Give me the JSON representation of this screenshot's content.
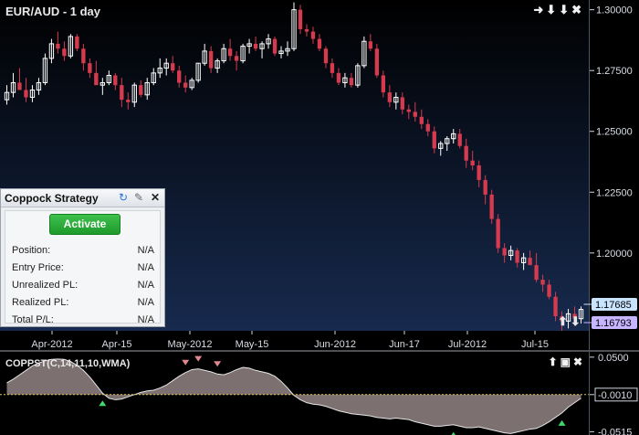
{
  "window": {
    "title": "EUR/AUD - 1 day",
    "indicator_title": "COPPST(C,14,11,10,WMA)"
  },
  "price_axis": {
    "ticks": [
      "1.30000",
      "1.27500",
      "1.25000",
      "1.22500",
      "1.20000"
    ],
    "last_price": "1.17685",
    "bid_price": "1.16793"
  },
  "indicator_axis": {
    "ticks": [
      "0.0500",
      "-0.0010",
      "-0.0515"
    ]
  },
  "time_axis": {
    "labels": [
      "Apr-2012",
      "Apr-15",
      "May-2012",
      "May-15",
      "Jun-2012",
      "Jun-17",
      "Jul-2012",
      "Jul-15"
    ]
  },
  "strategy_panel": {
    "title": "Coppock Strategy",
    "activate_label": "Activate",
    "rows": [
      {
        "label": "Position:",
        "value": "N/A"
      },
      {
        "label": "Entry Price:",
        "value": "N/A"
      },
      {
        "label": "Unrealized PL:",
        "value": "N/A"
      },
      {
        "label": "Realized PL:",
        "value": "N/A"
      },
      {
        "label": "Total P/L:",
        "value": "N/A"
      }
    ]
  },
  "icons": {
    "window_controls": [
      "arrow-right-icon",
      "arrow-down-icon",
      "arrow-down-icon",
      "close-icon"
    ],
    "indicator_controls": [
      "arrow-up-icon",
      "restore-icon",
      "close-icon"
    ],
    "panel_controls": [
      "refresh-icon",
      "wrench-icon",
      "close-icon"
    ],
    "scroll_controls": [
      "arrow-up-icon",
      "arrow-down-icon"
    ]
  },
  "colors": {
    "up_candle": "#ffffff",
    "down_candle": "#d63a4e",
    "background_top": "#000000",
    "background_bottom": "#172a4e",
    "indicator_fill_pos": "#8a7c7c",
    "indicator_fill_neg": "#a08080",
    "buy_marker": "#3fd86a",
    "sell_marker": "#e08890",
    "last_price_label": "#c9e4ff",
    "bid_price_label": "#c7b5ff"
  },
  "chart_data": {
    "type": "candlestick",
    "title": "EUR/AUD - 1 day",
    "ylim": [
      1.168,
      1.304
    ],
    "ohlc": [
      [
        1.263,
        1.269,
        1.261,
        1.266
      ],
      [
        1.266,
        1.274,
        1.264,
        1.27
      ],
      [
        1.27,
        1.276,
        1.268,
        1.267
      ],
      [
        1.267,
        1.272,
        1.262,
        1.264
      ],
      [
        1.264,
        1.269,
        1.262,
        1.267
      ],
      [
        1.267,
        1.272,
        1.265,
        1.27
      ],
      [
        1.27,
        1.282,
        1.269,
        1.28
      ],
      [
        1.28,
        1.288,
        1.278,
        1.286
      ],
      [
        1.286,
        1.291,
        1.282,
        1.284
      ],
      [
        1.284,
        1.287,
        1.279,
        1.281
      ],
      [
        1.281,
        1.29,
        1.28,
        1.289
      ],
      [
        1.289,
        1.29,
        1.283,
        1.284
      ],
      [
        1.284,
        1.286,
        1.275,
        1.278
      ],
      [
        1.278,
        1.28,
        1.272,
        1.274
      ],
      [
        1.274,
        1.279,
        1.269,
        1.269
      ],
      [
        1.269,
        1.272,
        1.265,
        1.27
      ],
      [
        1.27,
        1.275,
        1.269,
        1.273
      ],
      [
        1.273,
        1.274,
        1.267,
        1.269
      ],
      [
        1.269,
        1.272,
        1.26,
        1.263
      ],
      [
        1.263,
        1.266,
        1.259,
        1.262
      ],
      [
        1.262,
        1.27,
        1.26,
        1.269
      ],
      [
        1.269,
        1.271,
        1.264,
        1.265
      ],
      [
        1.265,
        1.272,
        1.263,
        1.27
      ],
      [
        1.27,
        1.276,
        1.269,
        1.274
      ],
      [
        1.274,
        1.28,
        1.272,
        1.276
      ],
      [
        1.276,
        1.28,
        1.273,
        1.278
      ],
      [
        1.278,
        1.281,
        1.274,
        1.275
      ],
      [
        1.275,
        1.277,
        1.268,
        1.27
      ],
      [
        1.27,
        1.273,
        1.266,
        1.268
      ],
      [
        1.268,
        1.272,
        1.267,
        1.271
      ],
      [
        1.271,
        1.278,
        1.27,
        1.278
      ],
      [
        1.278,
        1.286,
        1.277,
        1.283
      ],
      [
        1.283,
        1.285,
        1.274,
        1.276
      ],
      [
        1.276,
        1.28,
        1.274,
        1.279
      ],
      [
        1.279,
        1.286,
        1.278,
        1.284
      ],
      [
        1.284,
        1.288,
        1.279,
        1.281
      ],
      [
        1.281,
        1.283,
        1.275,
        1.279
      ],
      [
        1.279,
        1.286,
        1.278,
        1.285
      ],
      [
        1.285,
        1.288,
        1.282,
        1.286
      ],
      [
        1.286,
        1.289,
        1.283,
        1.284
      ],
      [
        1.284,
        1.287,
        1.28,
        1.286
      ],
      [
        1.286,
        1.29,
        1.284,
        1.288
      ],
      [
        1.288,
        1.289,
        1.281,
        1.282
      ],
      [
        1.282,
        1.285,
        1.28,
        1.283
      ],
      [
        1.283,
        1.287,
        1.281,
        1.284
      ],
      [
        1.284,
        1.303,
        1.283,
        1.3
      ],
      [
        1.3,
        1.302,
        1.29,
        1.292
      ],
      [
        1.292,
        1.294,
        1.289,
        1.291
      ],
      [
        1.291,
        1.293,
        1.286,
        1.288
      ],
      [
        1.288,
        1.29,
        1.283,
        1.284
      ],
      [
        1.284,
        1.285,
        1.276,
        1.278
      ],
      [
        1.278,
        1.28,
        1.272,
        1.274
      ],
      [
        1.274,
        1.276,
        1.269,
        1.27
      ],
      [
        1.27,
        1.274,
        1.268,
        1.272
      ],
      [
        1.272,
        1.274,
        1.268,
        1.269
      ],
      [
        1.269,
        1.278,
        1.268,
        1.277
      ],
      [
        1.277,
        1.289,
        1.276,
        1.287
      ],
      [
        1.287,
        1.29,
        1.283,
        1.284
      ],
      [
        1.284,
        1.286,
        1.272,
        1.273
      ],
      [
        1.273,
        1.275,
        1.264,
        1.266
      ],
      [
        1.266,
        1.269,
        1.26,
        1.262
      ],
      [
        1.262,
        1.266,
        1.259,
        1.264
      ],
      [
        1.264,
        1.266,
        1.257,
        1.259
      ],
      [
        1.259,
        1.261,
        1.255,
        1.258
      ],
      [
        1.258,
        1.262,
        1.254,
        1.256
      ],
      [
        1.256,
        1.259,
        1.251,
        1.253
      ],
      [
        1.253,
        1.255,
        1.248,
        1.25
      ],
      [
        1.25,
        1.252,
        1.241,
        1.243
      ],
      [
        1.243,
        1.246,
        1.24,
        1.245
      ],
      [
        1.245,
        1.248,
        1.242,
        1.247
      ],
      [
        1.247,
        1.251,
        1.245,
        1.249
      ],
      [
        1.249,
        1.251,
        1.243,
        1.244
      ],
      [
        1.244,
        1.247,
        1.235,
        1.238
      ],
      [
        1.238,
        1.242,
        1.234,
        1.236
      ],
      [
        1.236,
        1.238,
        1.227,
        1.23
      ],
      [
        1.23,
        1.232,
        1.22,
        1.224
      ],
      [
        1.224,
        1.226,
        1.212,
        1.214
      ],
      [
        1.214,
        1.216,
        1.2,
        1.202
      ],
      [
        1.202,
        1.204,
        1.196,
        1.199
      ],
      [
        1.199,
        1.203,
        1.197,
        1.201
      ],
      [
        1.201,
        1.202,
        1.194,
        1.196
      ],
      [
        1.196,
        1.2,
        1.193,
        1.198
      ],
      [
        1.198,
        1.201,
        1.195,
        1.195
      ],
      [
        1.195,
        1.2,
        1.188,
        1.189
      ],
      [
        1.189,
        1.191,
        1.184,
        1.187
      ],
      [
        1.187,
        1.189,
        1.181,
        1.182
      ],
      [
        1.182,
        1.184,
        1.172,
        1.174
      ],
      [
        1.174,
        1.176,
        1.168,
        1.172
      ],
      [
        1.172,
        1.177,
        1.169,
        1.175
      ],
      [
        1.175,
        1.178,
        1.17,
        1.173
      ],
      [
        1.173,
        1.178,
        1.171,
        1.1768
      ]
    ],
    "indicator": {
      "name": "COPPST(C,14,11,10,WMA)",
      "ylim": [
        -0.056,
        0.056
      ],
      "zero_line": -0.001,
      "values": [
        0.015,
        0.02,
        0.026,
        0.032,
        0.038,
        0.042,
        0.045,
        0.047,
        0.0475,
        0.047,
        0.044,
        0.039,
        0.032,
        0.023,
        0.012,
        0.001,
        -0.006,
        -0.008,
        -0.007,
        -0.004,
        -0.001,
        0.002,
        0.004,
        0.005,
        0.008,
        0.012,
        0.018,
        0.024,
        0.029,
        0.033,
        0.034,
        0.032,
        0.03,
        0.027,
        0.026,
        0.029,
        0.033,
        0.036,
        0.035,
        0.032,
        0.03,
        0.028,
        0.024,
        0.017,
        0.008,
        -0.002,
        -0.008,
        -0.012,
        -0.014,
        -0.015,
        -0.017,
        -0.02,
        -0.023,
        -0.025,
        -0.027,
        -0.028,
        -0.029,
        -0.03,
        -0.032,
        -0.033,
        -0.034,
        -0.033,
        -0.034,
        -0.035,
        -0.038,
        -0.04,
        -0.042,
        -0.044,
        -0.044,
        -0.043,
        -0.042,
        -0.044,
        -0.046,
        -0.046,
        -0.045,
        -0.047,
        -0.049,
        -0.051,
        -0.053,
        -0.054,
        -0.052,
        -0.05,
        -0.048,
        -0.047,
        -0.043,
        -0.038,
        -0.032,
        -0.026,
        -0.018,
        -0.012,
        -0.006
      ],
      "buy_signals": [
        15,
        70,
        83,
        87
      ],
      "sell_signals": [
        28,
        30,
        33
      ]
    }
  }
}
